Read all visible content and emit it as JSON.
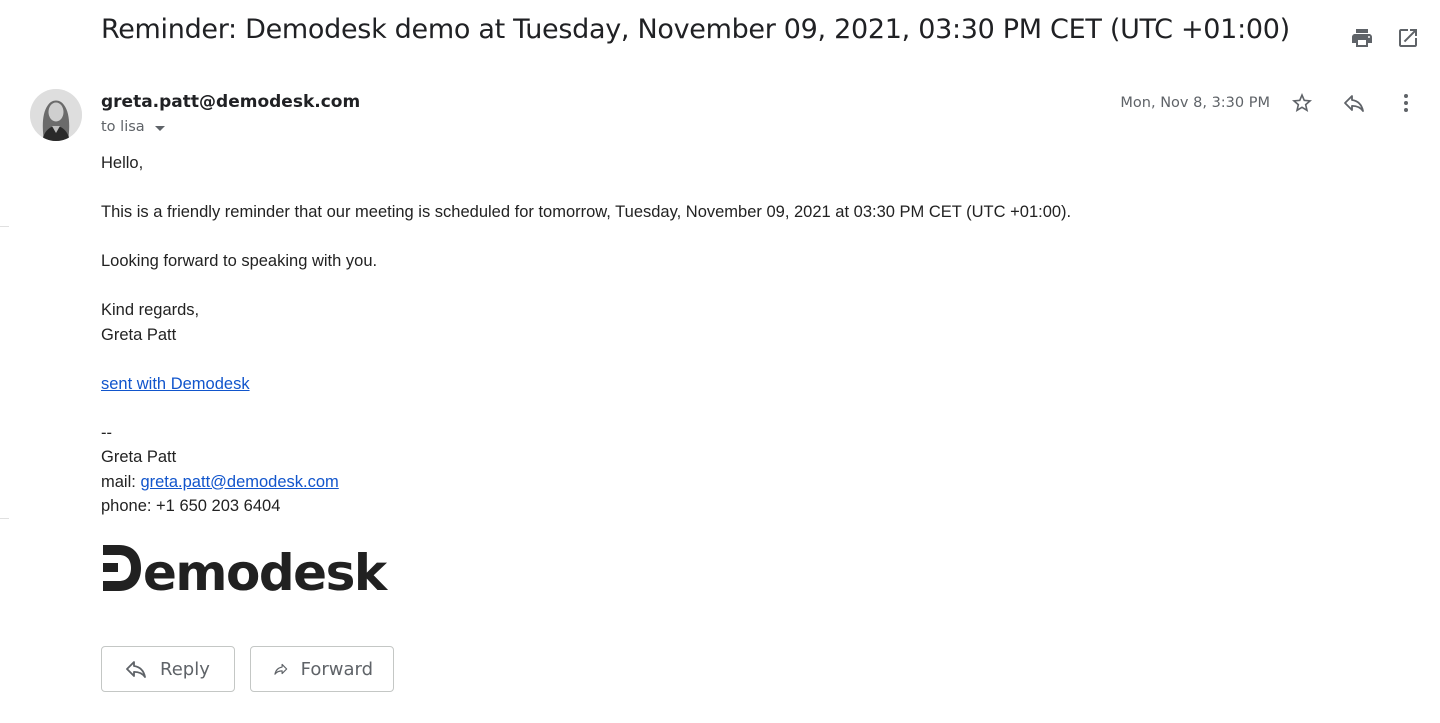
{
  "email": {
    "subject": "Reminder: Demodesk demo at Tuesday, November 09, 2021, 03:30 PM CET (UTC +01:00)",
    "sender": "greta.patt@demodesk.com",
    "recipient": "to lisa",
    "date": "Mon, Nov 8, 3:30 PM",
    "body": {
      "greeting": "Hello,",
      "paragraph1": "This is a friendly reminder that our meeting is scheduled for tomorrow, Tuesday, November 09, 2021 at 03:30 PM CET (UTC +01:00).",
      "paragraph2": "Looking forward to speaking with you.",
      "closing": "Kind regards,",
      "name": "Greta Patt",
      "sent_with_link": "sent with Demodesk",
      "sig_separator": "--",
      "sig_name": "Greta Patt",
      "sig_mail_label": "mail:",
      "sig_mail_link": "greta.patt@demodesk.com",
      "sig_phone": "phone: +1 650 203 6404"
    },
    "logo_text": "Demodesk"
  },
  "actions": {
    "reply_label": "Reply",
    "forward_label": "Forward"
  },
  "icons": {
    "print": "print-icon",
    "open_new_window": "open-in-new-icon",
    "star": "star-outline-icon",
    "reply": "reply-icon",
    "more": "more-vertical-icon",
    "forward": "forward-icon",
    "dropdown": "caret-down-icon"
  },
  "colors": {
    "link": "#1155cc",
    "text": "#202124",
    "secondary_text": "#5f6368",
    "button_border": "#c4c7c5"
  }
}
